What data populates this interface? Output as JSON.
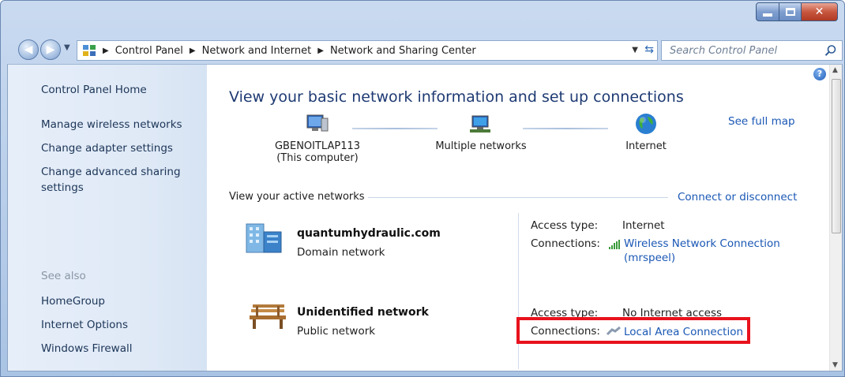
{
  "breadcrumb": [
    "Control Panel",
    "Network and Internet",
    "Network and Sharing Center"
  ],
  "search": {
    "placeholder": "Search Control Panel"
  },
  "sidebar": {
    "home": "Control Panel Home",
    "links": [
      "Manage wireless networks",
      "Change adapter settings",
      "Change advanced sharing settings"
    ],
    "see_also_label": "See also",
    "see_also": [
      "HomeGroup",
      "Internet Options",
      "Windows Firewall"
    ]
  },
  "main": {
    "title": "View your basic network information and set up connections",
    "see_full_map": "See full map",
    "map": {
      "computer": {
        "name": "GBENOITLAP113",
        "sub": "(This computer)"
      },
      "networks": "Multiple networks",
      "internet": "Internet"
    },
    "active_heading": "View your active networks",
    "connect_link": "Connect or disconnect",
    "networks": [
      {
        "name": "quantumhydraulic.com",
        "type": "Domain network",
        "access_label": "Access type:",
        "access_value": "Internet",
        "connections_label": "Connections:",
        "connection_line1": "Wireless Network Connection",
        "connection_line2": "(mrspeel)"
      },
      {
        "name": "Unidentified network",
        "type": "Public network",
        "access_label": "Access type:",
        "access_value": "No Internet access",
        "connections_label": "Connections:",
        "connection_line1": "Local Area Connection"
      }
    ]
  },
  "colors": {
    "link": "#1a57b5",
    "title": "#1e3a73",
    "highlight": "#e8121d"
  }
}
